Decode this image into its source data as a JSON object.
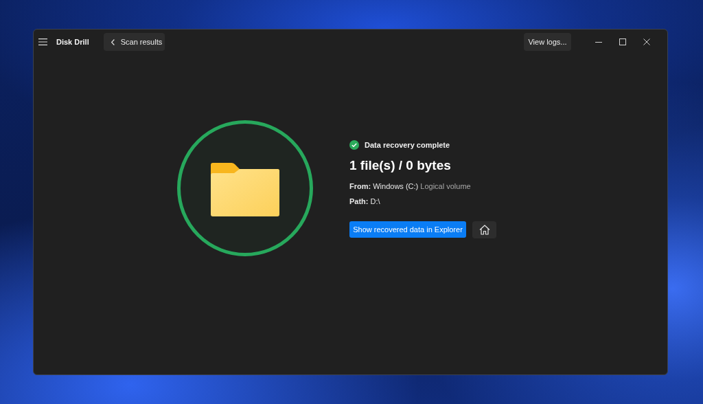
{
  "window": {
    "app_name": "Disk Drill",
    "back_button": "Scan results",
    "logs_button": "View logs..."
  },
  "result": {
    "status": "Data recovery complete",
    "summary": "1 file(s) / 0 bytes",
    "details": [
      {
        "label": "From:",
        "value": "Windows (C:)",
        "note": "Logical volume"
      },
      {
        "label": "Path:",
        "value": "D:\\"
      }
    ],
    "primary_button": "Show recovered data in Explorer"
  }
}
